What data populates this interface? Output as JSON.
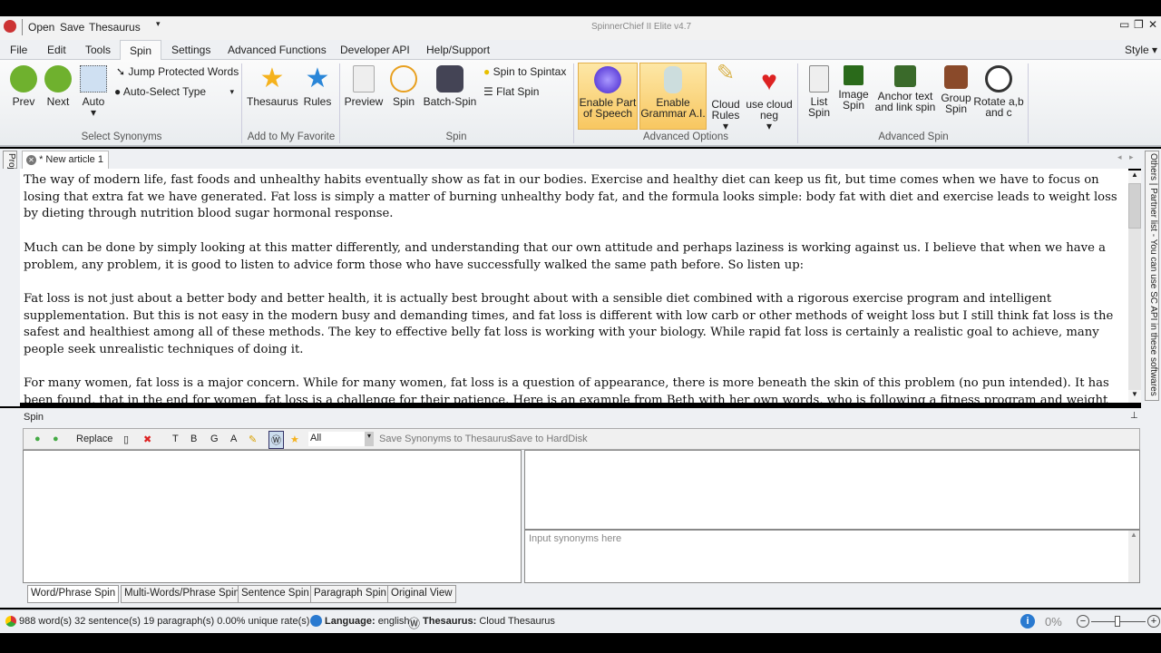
{
  "app": {
    "title": "SpinnerChief II Elite v4.7",
    "quick_access": [
      "Open",
      "Save",
      "Thesaurus"
    ],
    "style_label": "Style"
  },
  "menu": [
    "File",
    "Edit",
    "Tools",
    "Spin",
    "Settings",
    "Advanced Functions",
    "Developer API",
    "Help/Support"
  ],
  "ribbon": {
    "select_synonyms": {
      "prev": "Prev",
      "next": "Next",
      "auto": "Auto",
      "jump": "Jump Protected Words",
      "auto_select": "Auto-Select Type",
      "group": "Select Synonyms"
    },
    "favorite": {
      "thesaurus": "Thesaurus",
      "rules": "Rules",
      "group": "Add to My Favorite"
    },
    "spin": {
      "preview": "Preview",
      "spin": "Spin",
      "batch": "Batch-Spin",
      "spintax": "Spin to Spintax",
      "flat": "Flat Spin",
      "group": "Spin"
    },
    "advanced_options": {
      "pos": "Enable Part of Speech",
      "grammar": "Enable Grammar A.I.",
      "cloud_rules": "Cloud Rules",
      "cloud_neg": "use cloud neg",
      "group": "Advanced Options"
    },
    "advanced_spin": {
      "list": "List Spin",
      "image": "Image Spin",
      "anchor": "Anchor text and link spin",
      "group_spin": "Group Spin",
      "rotate": "Rotate a,b and c",
      "group": "Advanced Spin"
    }
  },
  "side": {
    "projects": "Project(s)",
    "others": "Others",
    "partner": "Partner list - You can use SC API in these softwares"
  },
  "document": {
    "tab": "* New article 1",
    "paragraphs": [
      "The way of modern life, fast foods and unhealthy habits eventually show as fat in our bodies. Exercise and healthy diet can keep us fit, but time comes when we have to focus on losing that extra fat we have generated. Fat loss is simply a matter of burning unhealthy body fat, and the formula looks simple: body fat with diet and exercise leads to weight loss by dieting through nutrition blood sugar hormonal response.",
      "Much can be done by simply looking at this matter differently, and understanding that our own attitude and perhaps laziness is working against us. I believe that when we have a problem, any problem, it is good to listen to advice form those who have successfully walked the same path before. So listen up:",
      "Fat loss is not just about a better body and better health, it is actually best brought about with a sensible diet combined with a rigorous exercise program and intelligent supplementation. But this is not easy in the modern busy and demanding times, and fat loss is different with low carb or other methods of weight loss but I still think fat loss is the safest and healthiest among all of these methods. The key to effective belly fat loss is working with your biology. While rapid fat loss is certainly a realistic goal to achieve, many people seek unrealistic techniques of doing it.",
      "For many women, fat loss is a major concern. While for many women, fat loss is a question of appearance, there is more beneath the skin of this problem (no pun intended). It has been found, that in the end for women, fat loss is a challenge for their patience. Here is an example from Beth with her own words, who is following a fitness program and weight"
    ]
  },
  "spin_panel": {
    "title": "Spin",
    "replace": "Replace",
    "fmt": [
      "T",
      "B",
      "G",
      "A"
    ],
    "filter": "All",
    "save_syn": "Save Synonyms to Thesaurus",
    "save_disk": "Save to HardDisk",
    "input_placeholder": "Input synonyms here",
    "tabs": [
      "Word/Phrase Spin",
      "Multi-Words/Phrase Spin",
      "Sentence Spin",
      "Paragraph Spin",
      "Original View"
    ]
  },
  "status": {
    "counts": "988 word(s) 32 sentence(s) 19 paragraph(s) 0.00% unique rate(s)",
    "language_label": "Language:",
    "language": "english",
    "thesaurus_label": "Thesaurus:",
    "thesaurus": "Cloud Thesaurus",
    "zoom": "0%"
  }
}
